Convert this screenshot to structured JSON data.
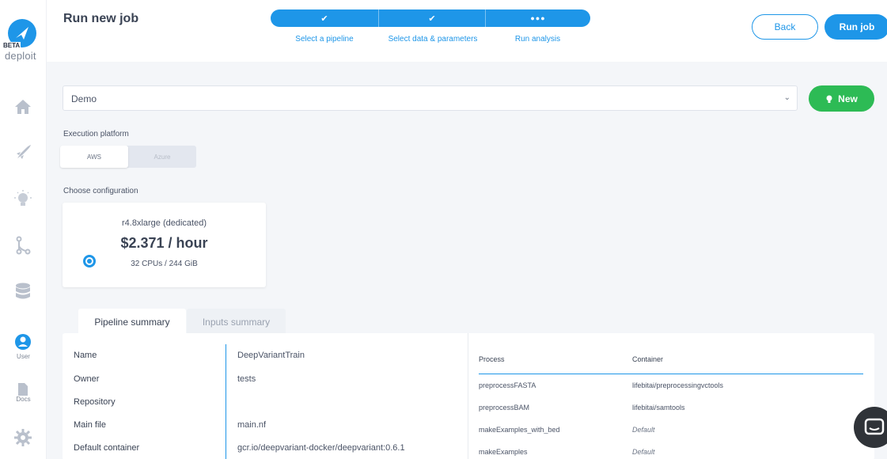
{
  "sidebar": {
    "logo_badge": "BETA",
    "logo_text": "deploit",
    "items": [
      {
        "icon": "home-icon"
      },
      {
        "icon": "rocket-icon"
      },
      {
        "icon": "lightbulb-icon"
      },
      {
        "icon": "pipeline-branch-icon"
      },
      {
        "icon": "database-icon"
      },
      {
        "icon": "user-icon",
        "label": "User"
      },
      {
        "icon": "docs-icon",
        "label": "Docs"
      },
      {
        "icon": "gear-icon"
      }
    ]
  },
  "header": {
    "title": "Run new job",
    "steps": [
      {
        "label": "Select a pipeline",
        "state": "done"
      },
      {
        "label": "Select data & parameters",
        "state": "done"
      },
      {
        "label": "Run analysis",
        "state": "current"
      }
    ],
    "back_label": "Back",
    "run_label": "Run job"
  },
  "project_select": {
    "value": "Demo",
    "new_label": "New"
  },
  "execution": {
    "label": "Execution platform",
    "options": [
      "AWS",
      "Azure"
    ],
    "selected": "AWS"
  },
  "configuration": {
    "label": "Choose configuration",
    "name": "r4.8xlarge (dedicated)",
    "price": "$2.371 / hour",
    "spec": "32 CPUs / 244 GiB"
  },
  "tabs": {
    "active": "Pipeline summary",
    "inactive": "Inputs summary"
  },
  "summary": {
    "rows": [
      {
        "key": "Name",
        "value": "DeepVariantTrain"
      },
      {
        "key": "Owner",
        "value": "tests"
      },
      {
        "key": "Repository",
        "value": ""
      },
      {
        "key": "Main file",
        "value": "main.nf"
      },
      {
        "key": "Default container",
        "value": "gcr.io/deepvariant-docker/deepvariant:0.6.1"
      }
    ],
    "process_header": "Process",
    "container_header": "Container",
    "processes": [
      {
        "process": "preprocessFASTA",
        "container": "lifebitai/preprocessingvctools",
        "default": false
      },
      {
        "process": "preprocessBAM",
        "container": "lifebitai/samtools",
        "default": false
      },
      {
        "process": "makeExamples_with_bed",
        "container": "Default",
        "default": true
      },
      {
        "process": "makeExamples",
        "container": "Default",
        "default": true
      }
    ]
  },
  "colors": {
    "accent": "#1e96e8",
    "success": "#2dbb55"
  }
}
